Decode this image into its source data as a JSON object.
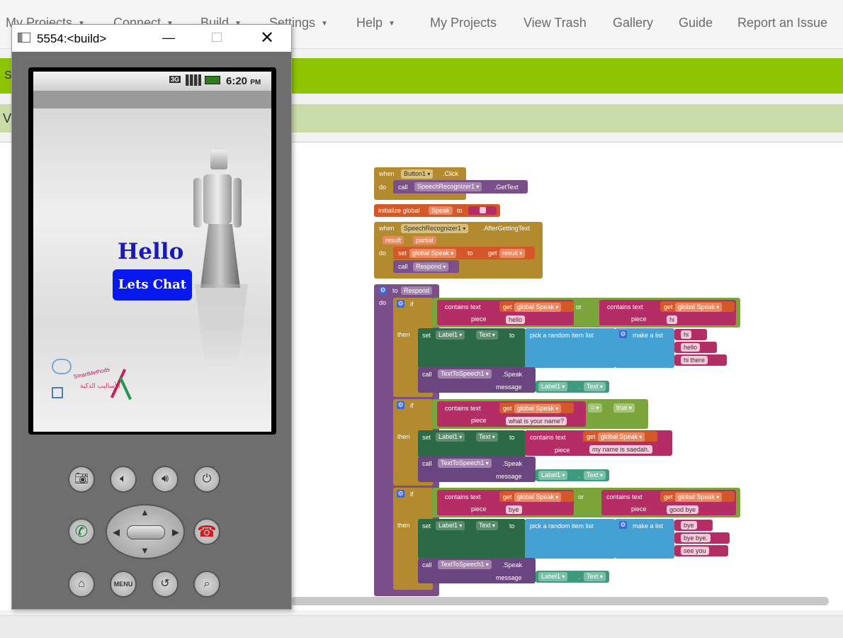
{
  "topnav": {
    "menus": [
      "My Projects",
      "Connect",
      "Build",
      "Settings",
      "Help"
    ],
    "links": [
      "My Projects",
      "View Trash",
      "Gallery",
      "Guide",
      "Report an Issue"
    ]
  },
  "side_letters": {
    "s": "S",
    "v": "V"
  },
  "emulator": {
    "title": "5554:<build>",
    "status_time": "6:20",
    "status_ampm": "PM",
    "net": "3G",
    "hello": "Hello",
    "lets_chat": "Lets Chat",
    "logo_text": "SmartMethods",
    "logo_arabic": "الأساليب الذكية",
    "menu_key": "MENU"
  },
  "blocks": {
    "when": "when",
    "do": "do",
    "call": "call",
    "set": "set",
    "to": "to",
    "get": "get",
    "if": "if",
    "then": "then",
    "or": "or",
    "piece": "piece",
    "message": "message",
    "contains_text": "contains text",
    "pick_random": "pick a random item  list",
    "make_list": "make a list",
    "button1": "Button1",
    "click": ".Click",
    "speech_rec": "SpeechRecognizer1",
    "get_text": ".GetText",
    "init_global": "initialize global",
    "speak": "Speak",
    "after_getting_text": ".AfterGettingText",
    "result": "result",
    "partial": "partial",
    "global_speak": "global Speak",
    "respond": "Respond",
    "to_respond": "to",
    "label1": "Label1",
    "text": "Text",
    "tts": "TextToSpeech1",
    "dot_speak": ".Speak",
    "dot": ".",
    "eq": "=",
    "true_val": "true",
    "s_hello": "hello",
    "s_hi": "hi",
    "s_hi_there": "hi there",
    "s_whats_name": "what is your name?",
    "s_my_name": "my name is saedah.",
    "s_bye": "bye",
    "s_good_bye": "good bye",
    "s_bye_bye": "bye bye.",
    "s_see_you": "see you"
  }
}
